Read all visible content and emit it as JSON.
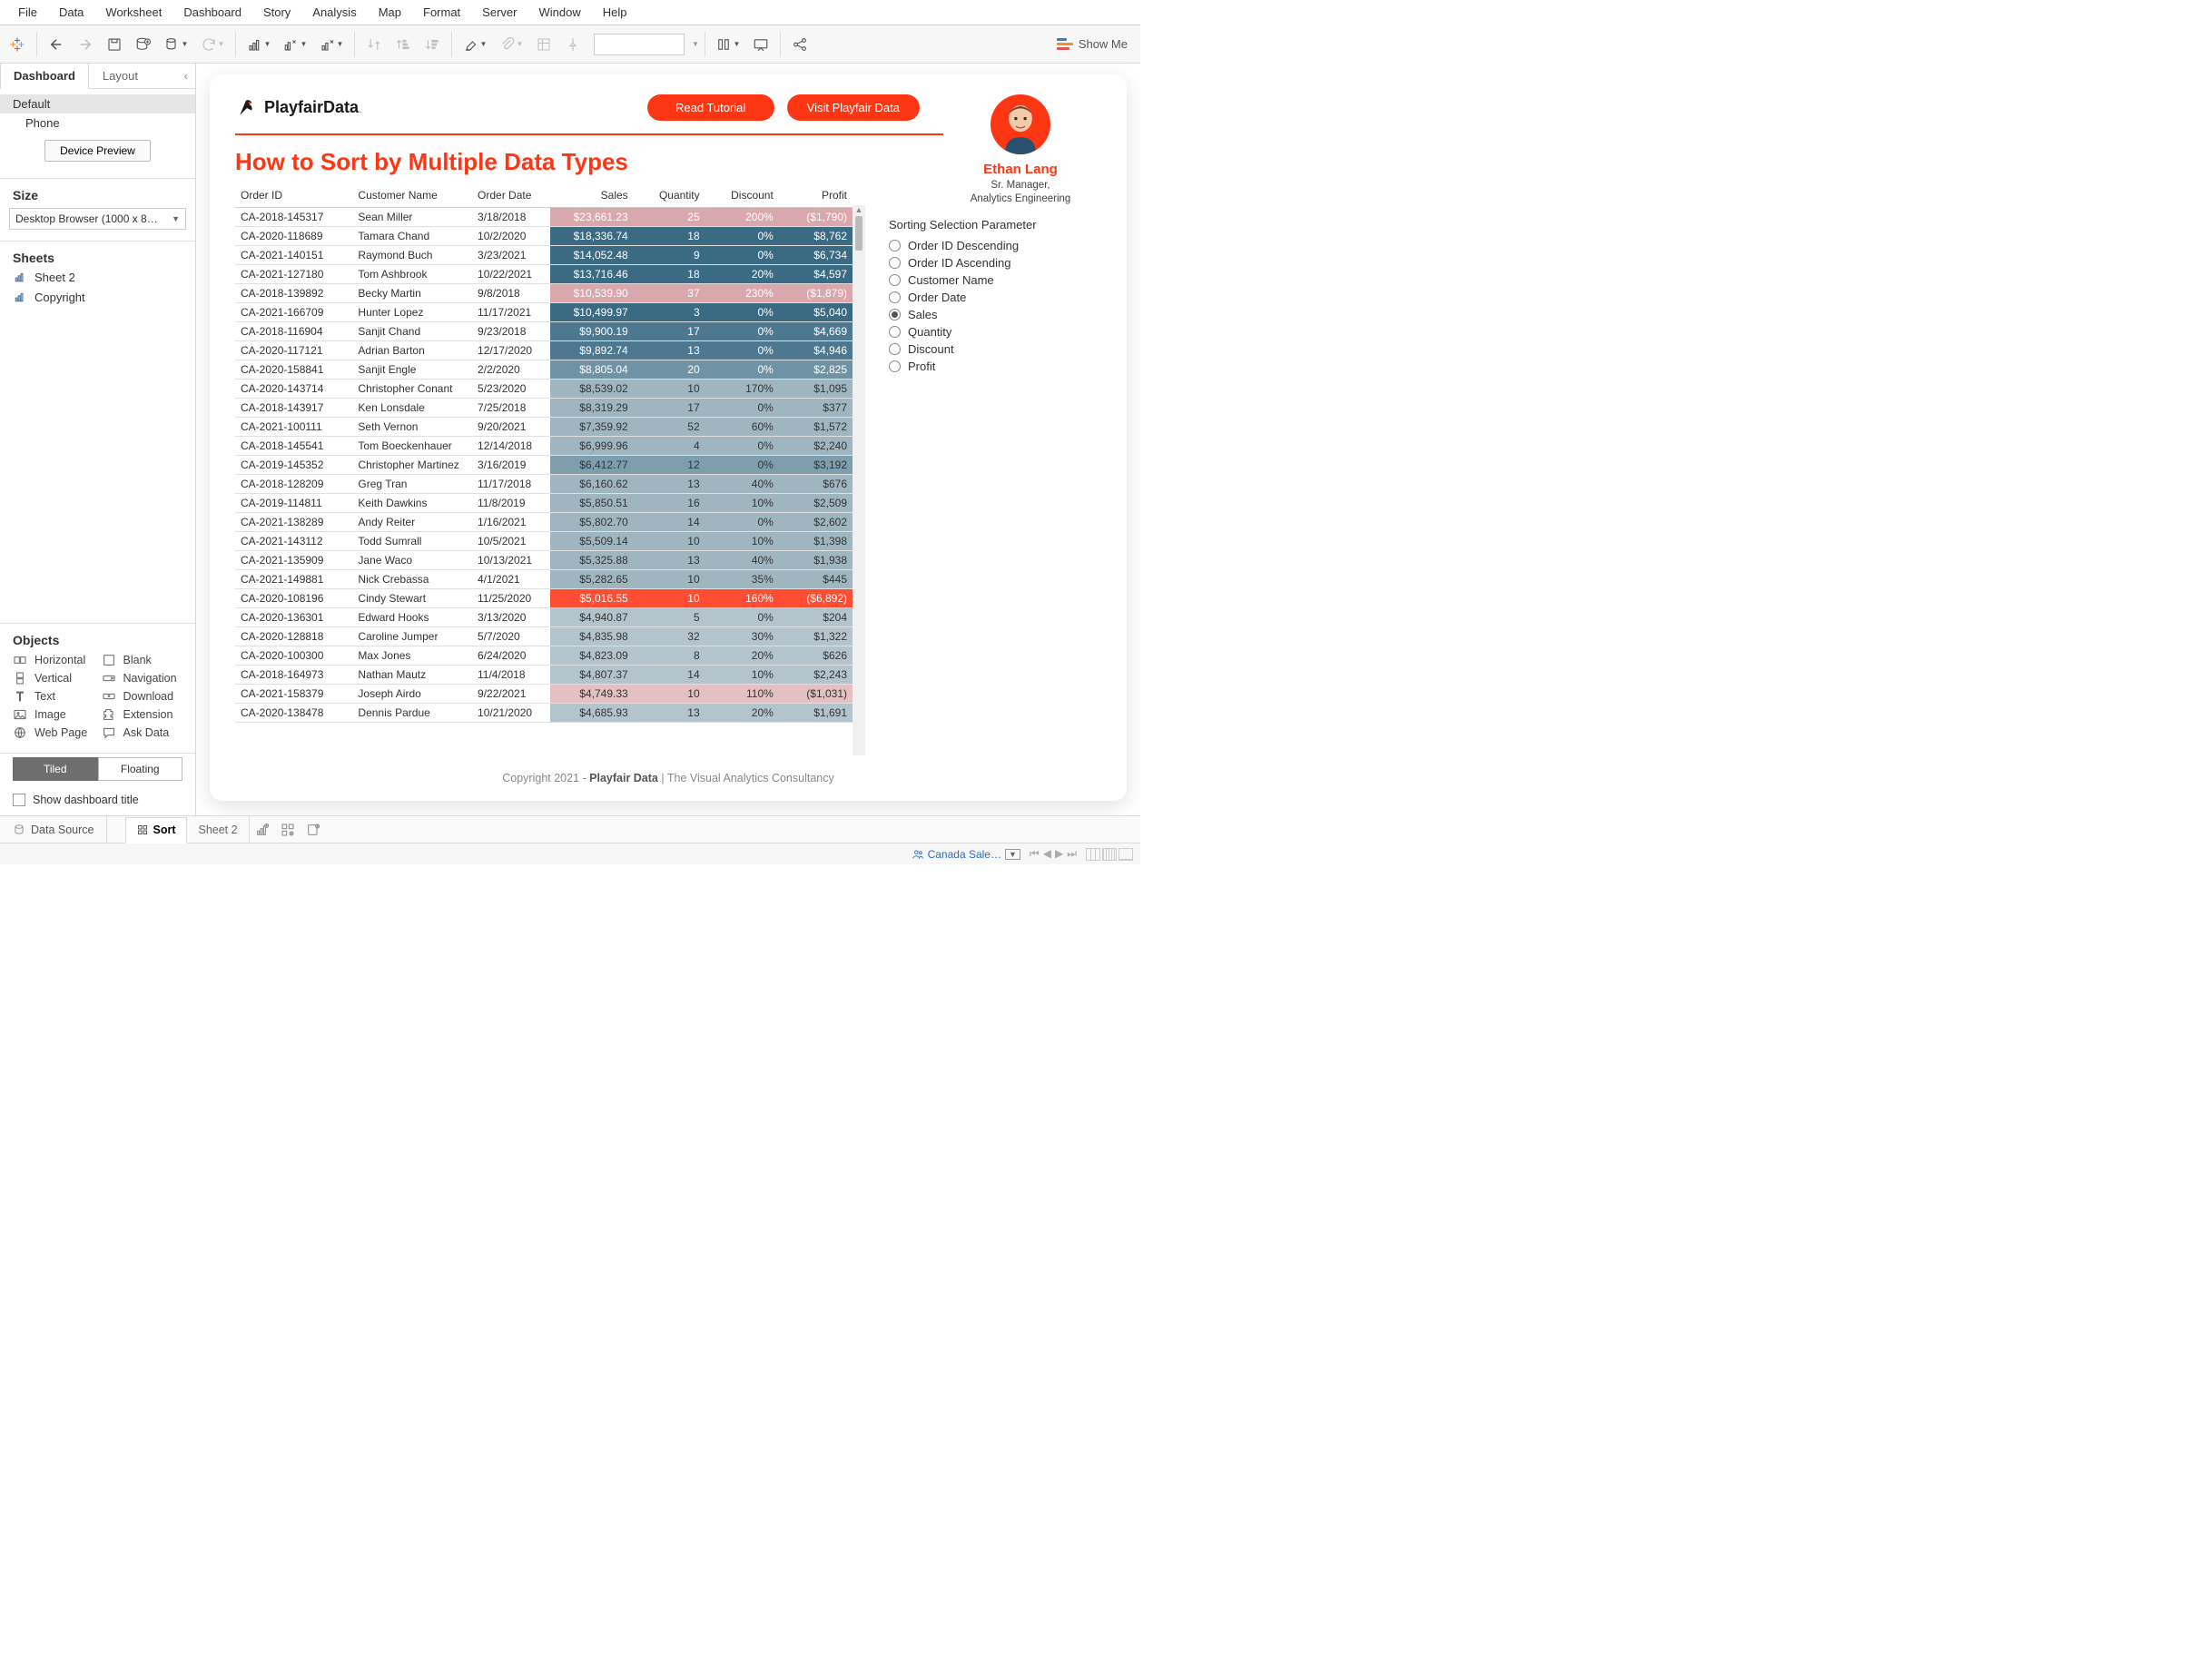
{
  "menu": [
    "File",
    "Data",
    "Worksheet",
    "Dashboard",
    "Story",
    "Analysis",
    "Map",
    "Format",
    "Server",
    "Window",
    "Help"
  ],
  "showme": "Show Me",
  "sidebar": {
    "tabs": {
      "dashboard": "Dashboard",
      "layout": "Layout"
    },
    "devices": {
      "default": "Default",
      "phone": "Phone",
      "preview_btn": "Device Preview"
    },
    "size": {
      "head": "Size",
      "value": "Desktop Browser (1000 x 8…"
    },
    "sheets": {
      "head": "Sheets",
      "items": [
        "Sheet 2",
        "Copyright"
      ]
    },
    "objects": {
      "head": "Objects",
      "items": [
        [
          "Horizontal",
          "Blank"
        ],
        [
          "Vertical",
          "Navigation"
        ],
        [
          "Text",
          "Download"
        ],
        [
          "Image",
          "Extension"
        ],
        [
          "Web Page",
          "Ask Data"
        ]
      ]
    },
    "tiled": {
      "tiled": "Tiled",
      "floating": "Floating"
    },
    "showtitle": "Show dashboard title"
  },
  "dashboard": {
    "logo": "PlayfairData",
    "logo_suffix": ".",
    "buttons": {
      "tutorial": "Read Tutorial",
      "visit": "Visit Playfair Data"
    },
    "title": "How to Sort by Multiple Data Types",
    "profile": {
      "name": "Ethan Lang",
      "title1": "Sr. Manager,",
      "title2": "Analytics Engineering"
    },
    "param": {
      "head": "Sorting Selection Parameter",
      "options": [
        "Order ID Descending",
        "Order ID Ascending",
        "Customer Name",
        "Order Date",
        "Sales",
        "Quantity",
        "Discount",
        "Profit"
      ],
      "selected": 4
    },
    "columns": [
      "Order ID",
      "Customer Name",
      "Order Date",
      "Sales",
      "Quantity",
      "Discount",
      "Profit"
    ],
    "rows": [
      {
        "id": "CA-2018-145317",
        "cust": "Sean Miller",
        "date": "3/18/2018",
        "sales": "$23,661.23",
        "qty": "25",
        "disc": "200%",
        "profit": "($1,790)",
        "sc": "#d9a8ad",
        "qc": "#d9a8ad",
        "dc": "#d9a8ad",
        "pc": "#d9a8ad"
      },
      {
        "id": "CA-2020-118689",
        "cust": "Tamara Chand",
        "date": "10/2/2020",
        "sales": "$18,336.74",
        "qty": "18",
        "disc": "0%",
        "profit": "$8,762",
        "sc": "#3b6a83",
        "qc": "#3b6a83",
        "dc": "#3b6a83",
        "pc": "#3b6a83"
      },
      {
        "id": "CA-2021-140151",
        "cust": "Raymond Buch",
        "date": "3/23/2021",
        "sales": "$14,052.48",
        "qty": "9",
        "disc": "0%",
        "profit": "$6,734",
        "sc": "#3b6a83",
        "qc": "#3b6a83",
        "dc": "#3b6a83",
        "pc": "#3b6a83"
      },
      {
        "id": "CA-2021-127180",
        "cust": "Tom Ashbrook",
        "date": "10/22/2021",
        "sales": "$13,716.46",
        "qty": "18",
        "disc": "20%",
        "profit": "$4,597",
        "sc": "#3b6a83",
        "qc": "#3b6a83",
        "dc": "#3b6a83",
        "pc": "#3b6a83"
      },
      {
        "id": "CA-2018-139892",
        "cust": "Becky Martin",
        "date": "9/8/2018",
        "sales": "$10,539.90",
        "qty": "37",
        "disc": "230%",
        "profit": "($1,879)",
        "sc": "#d9a8ad",
        "qc": "#d9a8ad",
        "dc": "#d9a8ad",
        "pc": "#d9a8ad"
      },
      {
        "id": "CA-2021-166709",
        "cust": "Hunter Lopez",
        "date": "11/17/2021",
        "sales": "$10,499.97",
        "qty": "3",
        "disc": "0%",
        "profit": "$5,040",
        "sc": "#3b6a83",
        "qc": "#3b6a83",
        "dc": "#3b6a83",
        "pc": "#3b6a83"
      },
      {
        "id": "CA-2018-116904",
        "cust": "Sanjit Chand",
        "date": "9/23/2018",
        "sales": "$9,900.19",
        "qty": "17",
        "disc": "0%",
        "profit": "$4,669",
        "sc": "#4d7890",
        "qc": "#4d7890",
        "dc": "#4d7890",
        "pc": "#4d7890"
      },
      {
        "id": "CA-2020-117121",
        "cust": "Adrian Barton",
        "date": "12/17/2020",
        "sales": "$9,892.74",
        "qty": "13",
        "disc": "0%",
        "profit": "$4,946",
        "sc": "#4d7890",
        "qc": "#4d7890",
        "dc": "#4d7890",
        "pc": "#4d7890"
      },
      {
        "id": "CA-2020-158841",
        "cust": "Sanjit Engle",
        "date": "2/2/2020",
        "sales": "$8,805.04",
        "qty": "20",
        "disc": "0%",
        "profit": "$2,825",
        "sc": "#6f93a4",
        "qc": "#6f93a4",
        "dc": "#6f93a4",
        "pc": "#6f93a4"
      },
      {
        "id": "CA-2020-143714",
        "cust": "Christopher Conant",
        "date": "5/23/2020",
        "sales": "$8,539.02",
        "qty": "10",
        "disc": "170%",
        "profit": "$1,095",
        "sc": "#9fb6c1",
        "qc": "#9fb6c1",
        "dc": "#9fb6c1",
        "pc": "#9fb6c1",
        "dark": true
      },
      {
        "id": "CA-2018-143917",
        "cust": "Ken Lonsdale",
        "date": "7/25/2018",
        "sales": "$8,319.29",
        "qty": "17",
        "disc": "0%",
        "profit": "$377",
        "sc": "#9fb6c1",
        "qc": "#9fb6c1",
        "dc": "#9fb6c1",
        "pc": "#9fb6c1",
        "dark": true
      },
      {
        "id": "CA-2021-100111",
        "cust": "Seth Vernon",
        "date": "9/20/2021",
        "sales": "$7,359.92",
        "qty": "52",
        "disc": "60%",
        "profit": "$1,572",
        "sc": "#9fb6c1",
        "qc": "#9fb6c1",
        "dc": "#9fb6c1",
        "pc": "#9fb6c1",
        "dark": true
      },
      {
        "id": "CA-2018-145541",
        "cust": "Tom Boeckenhauer",
        "date": "12/14/2018",
        "sales": "$6,999.96",
        "qty": "4",
        "disc": "0%",
        "profit": "$2,240",
        "sc": "#9fb6c1",
        "qc": "#9fb6c1",
        "dc": "#9fb6c1",
        "pc": "#9fb6c1",
        "dark": true
      },
      {
        "id": "CA-2019-145352",
        "cust": "Christopher Martinez",
        "date": "3/16/2019",
        "sales": "$6,412.77",
        "qty": "12",
        "disc": "0%",
        "profit": "$3,192",
        "sc": "#7e9eae",
        "qc": "#7e9eae",
        "dc": "#7e9eae",
        "pc": "#7e9eae",
        "dark": true
      },
      {
        "id": "CA-2018-128209",
        "cust": "Greg Tran",
        "date": "11/17/2018",
        "sales": "$6,160.62",
        "qty": "13",
        "disc": "40%",
        "profit": "$676",
        "sc": "#9fb6c1",
        "qc": "#9fb6c1",
        "dc": "#9fb6c1",
        "pc": "#9fb6c1",
        "dark": true
      },
      {
        "id": "CA-2019-114811",
        "cust": "Keith Dawkins",
        "date": "11/8/2019",
        "sales": "$5,850.51",
        "qty": "16",
        "disc": "10%",
        "profit": "$2,509",
        "sc": "#9fb6c1",
        "qc": "#9fb6c1",
        "dc": "#9fb6c1",
        "pc": "#9fb6c1",
        "dark": true
      },
      {
        "id": "CA-2021-138289",
        "cust": "Andy Reiter",
        "date": "1/16/2021",
        "sales": "$5,802.70",
        "qty": "14",
        "disc": "0%",
        "profit": "$2,602",
        "sc": "#9fb6c1",
        "qc": "#9fb6c1",
        "dc": "#9fb6c1",
        "pc": "#9fb6c1",
        "dark": true
      },
      {
        "id": "CA-2021-143112",
        "cust": "Todd Sumrall",
        "date": "10/5/2021",
        "sales": "$5,509.14",
        "qty": "10",
        "disc": "10%",
        "profit": "$1,398",
        "sc": "#9fb6c1",
        "qc": "#9fb6c1",
        "dc": "#9fb6c1",
        "pc": "#9fb6c1",
        "dark": true
      },
      {
        "id": "CA-2021-135909",
        "cust": "Jane Waco",
        "date": "10/13/2021",
        "sales": "$5,325.88",
        "qty": "13",
        "disc": "40%",
        "profit": "$1,938",
        "sc": "#9fb6c1",
        "qc": "#9fb6c1",
        "dc": "#9fb6c1",
        "pc": "#9fb6c1",
        "dark": true
      },
      {
        "id": "CA-2021-149881",
        "cust": "Nick Crebassa",
        "date": "4/1/2021",
        "sales": "$5,282.65",
        "qty": "10",
        "disc": "35%",
        "profit": "$445",
        "sc": "#9fb6c1",
        "qc": "#9fb6c1",
        "dc": "#9fb6c1",
        "pc": "#9fb6c1",
        "dark": true
      },
      {
        "id": "CA-2020-108196",
        "cust": "Cindy Stewart",
        "date": "11/25/2020",
        "sales": "$5,016.55",
        "qty": "10",
        "disc": "160%",
        "profit": "($6,892)",
        "sc": "#ff4d33",
        "qc": "#ff4d33",
        "dc": "#ff4d33",
        "pc": "#ff4d33"
      },
      {
        "id": "CA-2020-136301",
        "cust": "Edward Hooks",
        "date": "3/13/2020",
        "sales": "$4,940.87",
        "qty": "5",
        "disc": "0%",
        "profit": "$204",
        "sc": "#b3c4cd",
        "qc": "#b3c4cd",
        "dc": "#b3c4cd",
        "pc": "#b3c4cd",
        "dark": true
      },
      {
        "id": "CA-2020-128818",
        "cust": "Caroline Jumper",
        "date": "5/7/2020",
        "sales": "$4,835.98",
        "qty": "32",
        "disc": "30%",
        "profit": "$1,322",
        "sc": "#b3c4cd",
        "qc": "#b3c4cd",
        "dc": "#b3c4cd",
        "pc": "#b3c4cd",
        "dark": true
      },
      {
        "id": "CA-2020-100300",
        "cust": "Max Jones",
        "date": "6/24/2020",
        "sales": "$4,823.09",
        "qty": "8",
        "disc": "20%",
        "profit": "$626",
        "sc": "#b3c4cd",
        "qc": "#b3c4cd",
        "dc": "#b3c4cd",
        "pc": "#b3c4cd",
        "dark": true
      },
      {
        "id": "CA-2018-164973",
        "cust": "Nathan Mautz",
        "date": "11/4/2018",
        "sales": "$4,807.37",
        "qty": "14",
        "disc": "10%",
        "profit": "$2,243",
        "sc": "#b3c4cd",
        "qc": "#b3c4cd",
        "dc": "#b3c4cd",
        "pc": "#b3c4cd",
        "dark": true
      },
      {
        "id": "CA-2021-158379",
        "cust": "Joseph Airdo",
        "date": "9/22/2021",
        "sales": "$4,749.33",
        "qty": "10",
        "disc": "110%",
        "profit": "($1,031)",
        "sc": "#e4c0c3",
        "qc": "#e4c0c3",
        "dc": "#e4c0c3",
        "pc": "#e4c0c3",
        "dark": true
      },
      {
        "id": "CA-2020-138478",
        "cust": "Dennis Pardue",
        "date": "10/21/2020",
        "sales": "$4,685.93",
        "qty": "13",
        "disc": "20%",
        "profit": "$1,691",
        "sc": "#b3c4cd",
        "qc": "#b3c4cd",
        "dc": "#b3c4cd",
        "pc": "#b3c4cd",
        "dark": true
      }
    ],
    "copyright": {
      "pre": "Copyright 2021 - ",
      "bold": "Playfair Data",
      "post": " | The Visual Analytics Consultancy"
    }
  },
  "sheetbar": {
    "datasource": "Data Source",
    "tabs": [
      "Sort",
      "Sheet 2"
    ],
    "active": 0
  },
  "status": {
    "ds": "Canada Sale…"
  }
}
